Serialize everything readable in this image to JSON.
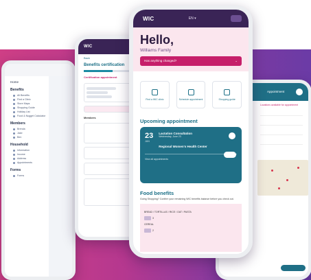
{
  "background": {
    "gradient_start": "#cf3f86",
    "gradient_end": "#6b3ba6"
  },
  "main_phone": {
    "logo": "WIC",
    "greeting": "Hello,",
    "family_name": "Williams Family",
    "alert_text": "Has anything changed?",
    "quick_actions": [
      {
        "label": "Find a WIC clinic",
        "icon": "location-icon"
      },
      {
        "label": "Schedule appointment",
        "icon": "calendar-icon"
      },
      {
        "label": "Shopping guide",
        "icon": "cart-icon"
      }
    ],
    "upcoming_heading": "Upcoming appointment",
    "appointment": {
      "day": "23",
      "month": "JUN",
      "type": "Lactation Consultation",
      "date": "Wednesday, June 23",
      "location": "Regional Women's Health Center"
    },
    "view_all": "View all appointments",
    "food_heading": "Food benefits",
    "food_sub": "Going Shopping? Confirm your remaining WIC benefits balance before you check out.",
    "food_items": [
      "BREAD / TORTILLAS / RICE / OAT / PASTA",
      "CEREAL"
    ]
  },
  "left_phone": {
    "home": "Home",
    "sections": [
      {
        "title": "Benefits",
        "items": [
          "All Benefits",
          "Find a Clinic",
          "Store Maps",
          "Shopping Guide",
          "Holiday List",
          "Food & Nugget Calculator"
        ]
      },
      {
        "title": "Members",
        "items": [
          "Brenda",
          "Jake",
          "Ben"
        ]
      },
      {
        "title": "Household",
        "items": [
          "Information",
          "Income",
          "Address",
          "Appointments"
        ]
      },
      {
        "title": "Forms",
        "items": [
          "Forms"
        ]
      }
    ]
  },
  "second_phone": {
    "back": "Back",
    "title": "Benefits certification",
    "section": "Certification appointment",
    "members": "Members"
  },
  "right_phone": {
    "title": "Appointment",
    "subtitle": "Locations available for appointment"
  }
}
